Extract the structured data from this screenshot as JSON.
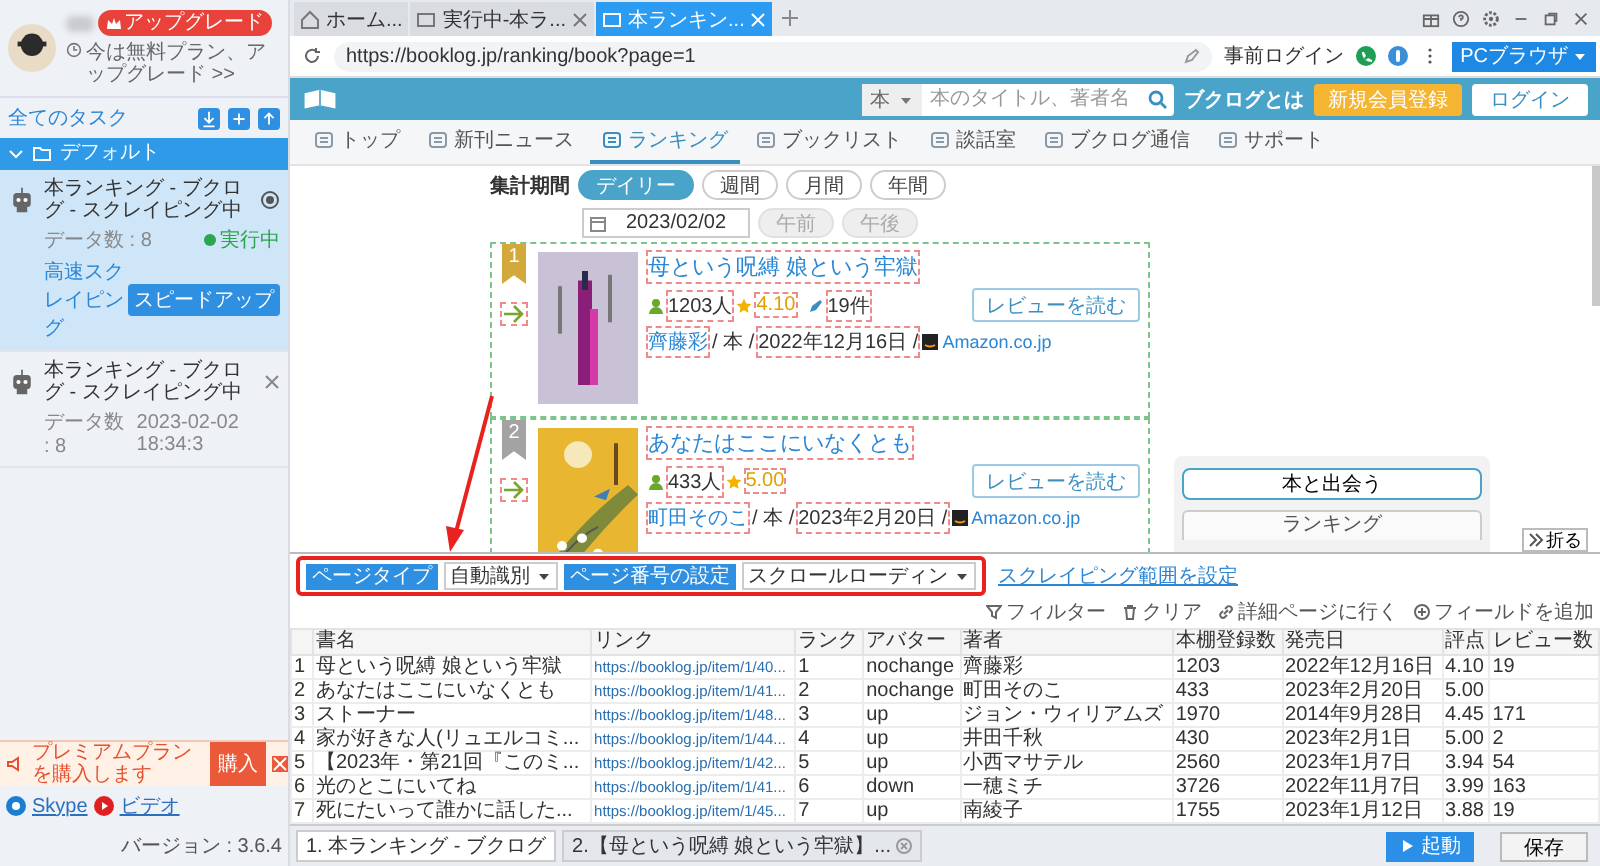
{
  "sidebar": {
    "upgrade_badge": "アップグレード",
    "plan_text": "今は無料プラン、アップグレード >>",
    "all_tasks": "全てのタスク",
    "group": {
      "name": "デフォルト",
      "expanded": true
    },
    "tasks": [
      {
        "title": "本ランキング - ブクログ - スクレイピング中",
        "data_label": "データ数 :",
        "data_count": "8",
        "status": "実行中",
        "mode": "高速スクレイピング",
        "speed_button": "スピードアップ",
        "selected": true
      },
      {
        "title": "本ランキング - ブクログ - スクレイピング中",
        "data_label": "データ数 :",
        "data_count": "8",
        "time": "2023-02-02 18:34:3",
        "selected": false
      }
    ],
    "promo": {
      "text": "プレミアムプランを購入します",
      "button": "購入"
    },
    "links": [
      "Skype",
      "ビデオ"
    ],
    "version": "バージョン : 3.6.4"
  },
  "browser": {
    "tabs": [
      {
        "label": "ホーム...",
        "selected": false
      },
      {
        "label": "実行中-本ラ...",
        "selected": false
      },
      {
        "label": "本ランキン...",
        "selected": true
      }
    ],
    "url": "https://booklog.jp/ranking/book?page=1",
    "pre_login": "事前ログイン",
    "mode_button": "PCブラウザ"
  },
  "page": {
    "search_category": "本",
    "search_placeholder": "本のタイトル、著者名",
    "about": "ブクログとは",
    "signup": "新規会員登録",
    "login": "ログイン",
    "nav": [
      {
        "label": "トップ",
        "selected": false
      },
      {
        "label": "新刊ニュース",
        "selected": false
      },
      {
        "label": "ランキング",
        "selected": true
      },
      {
        "label": "ブックリスト",
        "selected": false
      },
      {
        "label": "談話室",
        "selected": false
      },
      {
        "label": "ブクログ通信",
        "selected": false
      },
      {
        "label": "サポート",
        "selected": false
      }
    ],
    "period_label": "集計期間",
    "periods": [
      {
        "label": "デイリー",
        "selected": true
      },
      {
        "label": "週間",
        "selected": false
      },
      {
        "label": "月間",
        "selected": false
      },
      {
        "label": "年間",
        "selected": false
      }
    ],
    "date": "2023/02/02",
    "half_day": [
      {
        "label": "午前",
        "disabled": true
      },
      {
        "label": "午後",
        "disabled": true
      }
    ],
    "books": [
      {
        "rank": "1",
        "color": "#d4a93c",
        "title": "母という呪縛 娘という牢獄",
        "readers": "1203",
        "readers_unit": "人",
        "rating": "4.10",
        "reviews": "19",
        "reviews_unit": "件",
        "author": "齊藤彩",
        "type": "/ 本 /",
        "date": "2022年12月16日 /",
        "store": "Amazon.co.jp",
        "review_button": "レビューを読む"
      },
      {
        "rank": "2",
        "color": "#a3a3a3",
        "title": "あなたはここにいなくとも",
        "readers": "433",
        "readers_unit": "人",
        "rating": "5.00",
        "author": "町田そのこ",
        "type": "/ 本 /",
        "date": "2023年2月20日 /",
        "store": "Amazon.co.jp",
        "review_button": "レビューを読む"
      }
    ],
    "side_button": "本と出会う",
    "side_heading": "ランキング",
    "collapse": "折る"
  },
  "panel": {
    "page_type": {
      "label": "ページタイプ",
      "value": "自動識別"
    },
    "page_number": {
      "label": "ページ番号の設定",
      "value": "スクロールローディン"
    },
    "range_link": "スクレイピング範囲を設定",
    "actions": [
      "フィルター",
      "クリア",
      "詳細ページに行く",
      "フィールドを追加"
    ],
    "columns": [
      {
        "kind": "index"
      },
      {
        "label": "書名",
        "kind": "text"
      },
      {
        "label": "リンク",
        "kind": "link"
      },
      {
        "label": "ランク",
        "kind": "text"
      },
      {
        "label": "アバター",
        "kind": "text"
      },
      {
        "label": "著者",
        "kind": "text"
      },
      {
        "label": "本棚登録数",
        "kind": "text"
      },
      {
        "label": "発売日",
        "kind": "text"
      },
      {
        "label": "評点",
        "kind": "text"
      },
      {
        "label": "レビュー数",
        "kind": "text"
      }
    ],
    "rows": [
      {
        "cells": [
          "1",
          "母という呪縛 娘という牢獄",
          "https://booklog.jp/item/1/40...",
          "1",
          "nochange",
          "齊藤彩",
          "1203",
          "2022年12月16日",
          "4.10",
          "19"
        ]
      },
      {
        "cells": [
          "2",
          "あなたはここにいなくとも",
          "https://booklog.jp/item/1/41...",
          "2",
          "nochange",
          "町田そのこ",
          "433",
          "2023年2月20日",
          "5.00",
          null
        ]
      },
      {
        "cells": [
          "3",
          "ストーナー",
          "https://booklog.jp/item/1/48...",
          "3",
          "up",
          "ジョン・ウィリアムズ",
          "1970",
          "2014年9月28日",
          "4.45",
          "171"
        ]
      },
      {
        "cells": [
          "4",
          "家が好きな人(リュエルコミ...",
          "https://booklog.jp/item/1/44...",
          "4",
          "up",
          "井田千秋",
          "430",
          "2023年2月1日",
          "5.00",
          "2"
        ]
      },
      {
        "cells": [
          "5",
          "【2023年・第21回『このミ...",
          "https://booklog.jp/item/1/42...",
          "5",
          "up",
          "小西マサテル",
          "2560",
          "2023年1月7日",
          "3.94",
          "54"
        ]
      },
      {
        "cells": [
          "6",
          "光のとこにいてね",
          "https://booklog.jp/item/1/41...",
          "6",
          "down",
          "一穂ミチ",
          "3726",
          "2022年11月7日",
          "3.99",
          "163"
        ]
      },
      {
        "cells": [
          "7",
          "死にたいって誰かに話した...",
          "https://booklog.jp/item/1/45...",
          "7",
          "up",
          "南綾子",
          "1755",
          "2023年1月12日",
          "3.88",
          "19"
        ]
      }
    ]
  },
  "bottom": {
    "tabs": [
      {
        "label": "1. 本ランキング - ブクログ",
        "selected": true
      },
      {
        "label": "2.【母という呪縛 娘という牢獄】...",
        "selected": false
      }
    ],
    "start": "起動",
    "save": "保存"
  }
}
